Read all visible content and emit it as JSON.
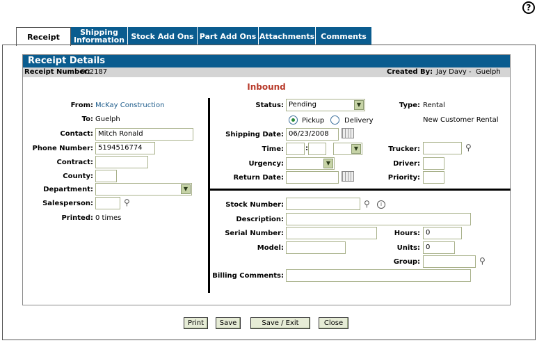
{
  "help_symbol": "?",
  "tabs": [
    {
      "label": "Receipt",
      "active": true
    },
    {
      "label": "Shipping Information",
      "active": false
    },
    {
      "label": "Stock Add Ons",
      "active": false
    },
    {
      "label": "Part Add Ons",
      "active": false
    },
    {
      "label": "Attachments",
      "active": false
    },
    {
      "label": "Comments",
      "active": false
    }
  ],
  "header": {
    "title": "Receipt Details",
    "receipt_number_label": "Receipt Number:",
    "receipt_number": "002187",
    "created_by_label": "Created By:",
    "created_by": "Jay Davy -  Guelph"
  },
  "direction": "Inbound",
  "left": {
    "from_label": "From:",
    "from_value": "McKay Construction",
    "to_label": "To:",
    "to_value": "Guelph",
    "contact_label": "Contact:",
    "contact_value": "Mitch Ronald",
    "phone_label": "Phone Number:",
    "phone_value": "5194516774",
    "contract_label": "Contract:",
    "contract_value": "",
    "county_label": "County:",
    "county_value": "",
    "department_label": "Department:",
    "department_value": "",
    "salesperson_label": "Salesperson:",
    "salesperson_value": "",
    "printed_label": "Printed:",
    "printed_value": "0 times"
  },
  "top_right": {
    "status_label": "Status:",
    "status_value": "Pending",
    "type_label": "Type:",
    "type_value": "Rental",
    "pickup_label": "Pickup",
    "delivery_label": "Delivery",
    "rental_kind": "New Customer Rental",
    "shipping_date_label": "Shipping Date:",
    "shipping_date_value": "06/23/2008",
    "time_label": "Time:",
    "time_separator": ":",
    "trucker_label": "Trucker:",
    "urgency_label": "Urgency:",
    "driver_label": "Driver:",
    "return_date_label": "Return Date:",
    "priority_label": "Priority:"
  },
  "bottom_right": {
    "stock_number_label": "Stock Number:",
    "description_label": "Description:",
    "serial_number_label": "Serial Number:",
    "hours_label": "Hours:",
    "hours_value": "0",
    "model_label": "Model:",
    "units_label": "Units:",
    "units_value": "0",
    "group_label": "Group:",
    "billing_comments_label": "Billing Comments:"
  },
  "buttons": {
    "print": "Print",
    "save": "Save",
    "save_exit": "Save / Exit",
    "close": "Close"
  },
  "icons": {
    "help": "help-icon",
    "calendar": "calendar-icon",
    "search": "magnifier-icon",
    "info": "info-icon",
    "dropdown": "chevron-down-icon"
  }
}
